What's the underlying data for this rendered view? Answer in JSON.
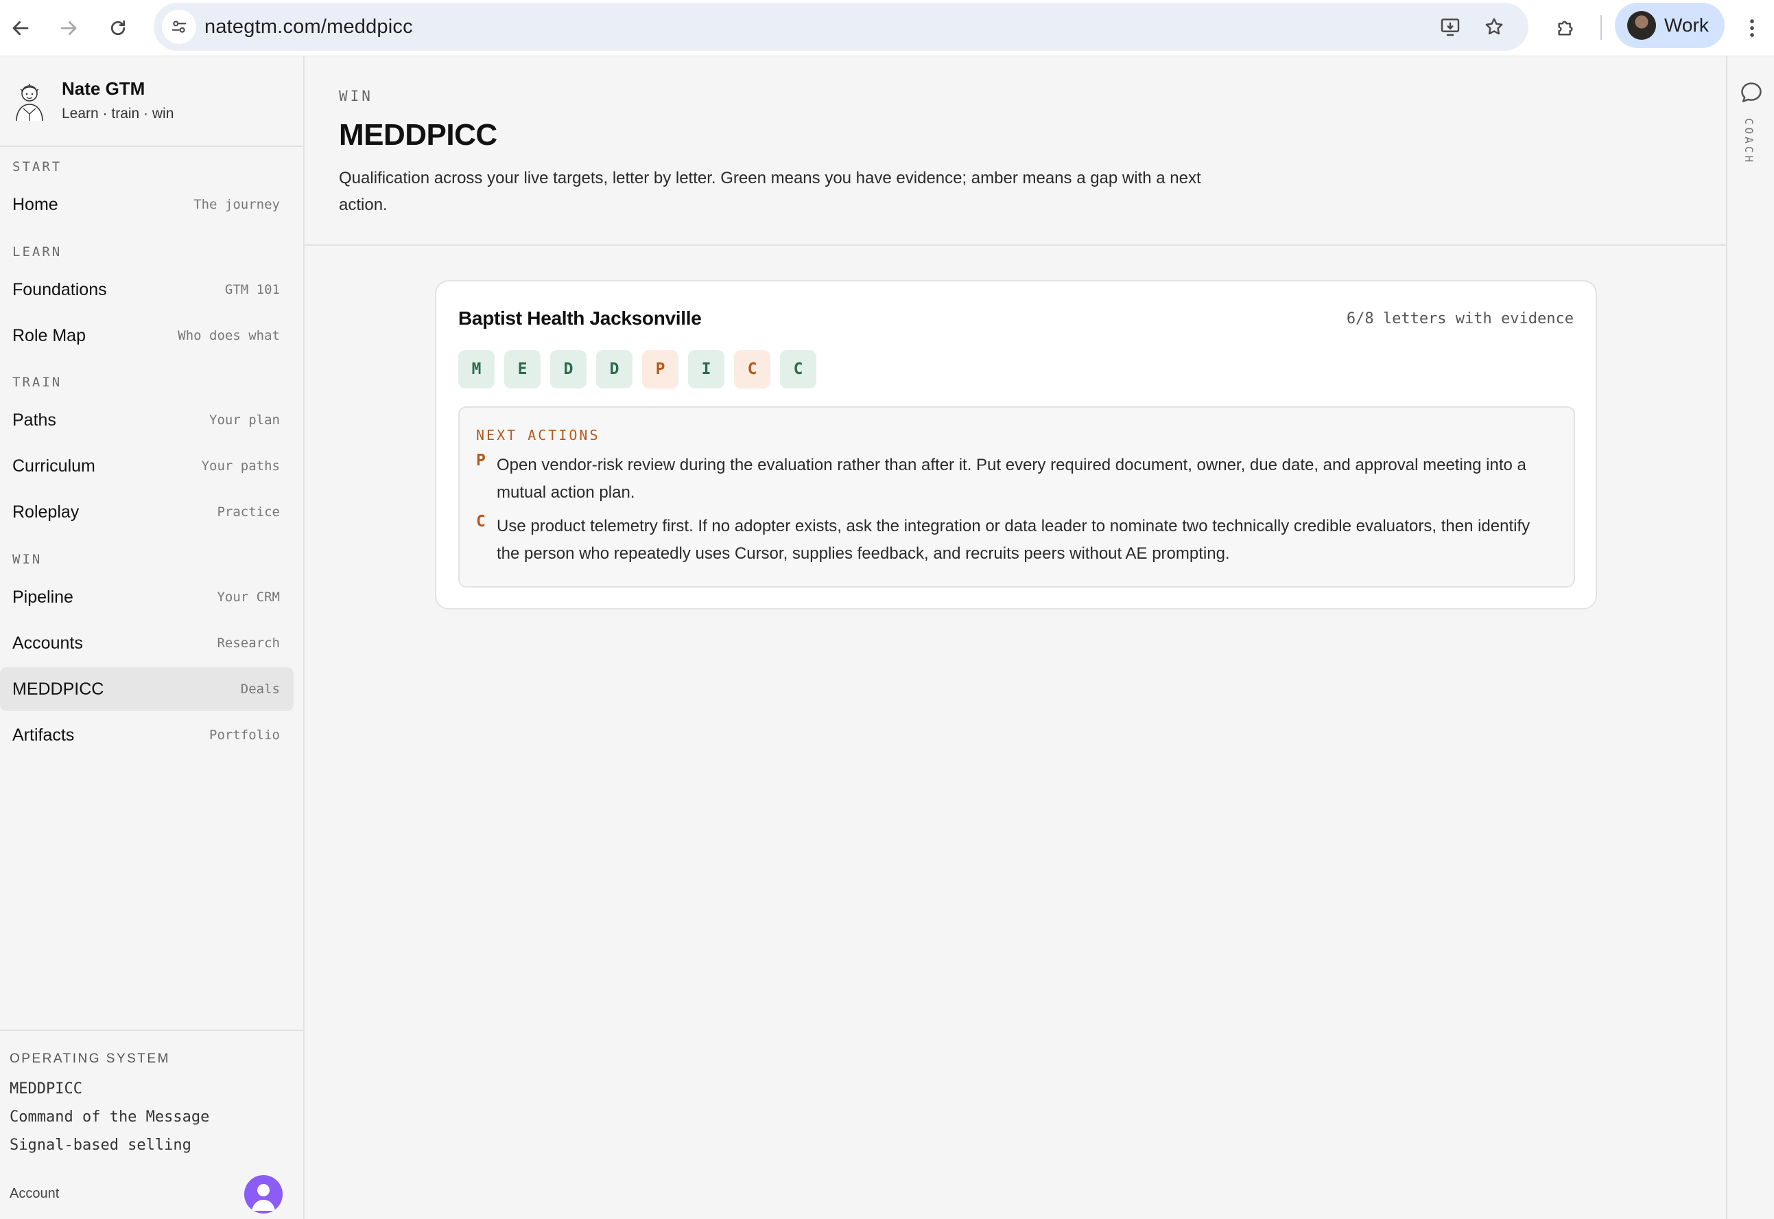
{
  "browser": {
    "url": "nategtm.com/meddpicc",
    "profile_label": "Work"
  },
  "brand": {
    "name": "Nate GTM",
    "tagline": "Learn · train · win"
  },
  "sidebar": {
    "sections": [
      {
        "label": "START",
        "items": [
          {
            "label": "Home",
            "hint": "The journey"
          }
        ]
      },
      {
        "label": "LEARN",
        "items": [
          {
            "label": "Foundations",
            "hint": "GTM 101"
          },
          {
            "label": "Role Map",
            "hint": "Who does what"
          }
        ]
      },
      {
        "label": "TRAIN",
        "items": [
          {
            "label": "Paths",
            "hint": "Your plan"
          },
          {
            "label": "Curriculum",
            "hint": "Your paths"
          },
          {
            "label": "Roleplay",
            "hint": "Practice"
          }
        ]
      },
      {
        "label": "WIN",
        "items": [
          {
            "label": "Pipeline",
            "hint": "Your CRM"
          },
          {
            "label": "Accounts",
            "hint": "Research"
          },
          {
            "label": "MEDDPICC",
            "hint": "Deals",
            "active": true
          },
          {
            "label": "Artifacts",
            "hint": "Portfolio"
          }
        ]
      }
    ],
    "operating_system": {
      "title": "OPERATING SYSTEM",
      "items": [
        "MEDDPICC",
        "Command of the Message",
        "Signal-based selling"
      ]
    },
    "account_label": "Account"
  },
  "page": {
    "eyebrow": "WIN",
    "title": "MEDDPICC",
    "description": "Qualification across your live targets, letter by letter. Green means you have evidence; amber means a gap with a next action."
  },
  "deal": {
    "account": "Baptist Health Jacksonville",
    "evidence_summary": "6/8 letters with evidence",
    "letters": [
      {
        "letter": "M",
        "status": "green"
      },
      {
        "letter": "E",
        "status": "green"
      },
      {
        "letter": "D",
        "status": "green"
      },
      {
        "letter": "D",
        "status": "green"
      },
      {
        "letter": "P",
        "status": "amber"
      },
      {
        "letter": "I",
        "status": "green"
      },
      {
        "letter": "C",
        "status": "amber"
      },
      {
        "letter": "C",
        "status": "green"
      }
    ],
    "next_actions_title": "NEXT ACTIONS",
    "next_actions": [
      {
        "letter": "P",
        "text": "Open vendor-risk review during the evaluation rather than after it. Put every required document, owner, due date, and approval meeting into a mutual action plan."
      },
      {
        "letter": "C",
        "text": "Use product telemetry first. If no adopter exists, ask the integration or data leader to nominate two technically credible evaluators, then identify the person who repeatedly uses Cursor, supplies feedback, and recruits peers without AE prompting."
      }
    ]
  },
  "coach": {
    "label": "COACH"
  },
  "colors": {
    "evidence_green": "#2d6a4c",
    "gap_amber": "#b55a1c",
    "active_nav": "#e6e6e6"
  }
}
